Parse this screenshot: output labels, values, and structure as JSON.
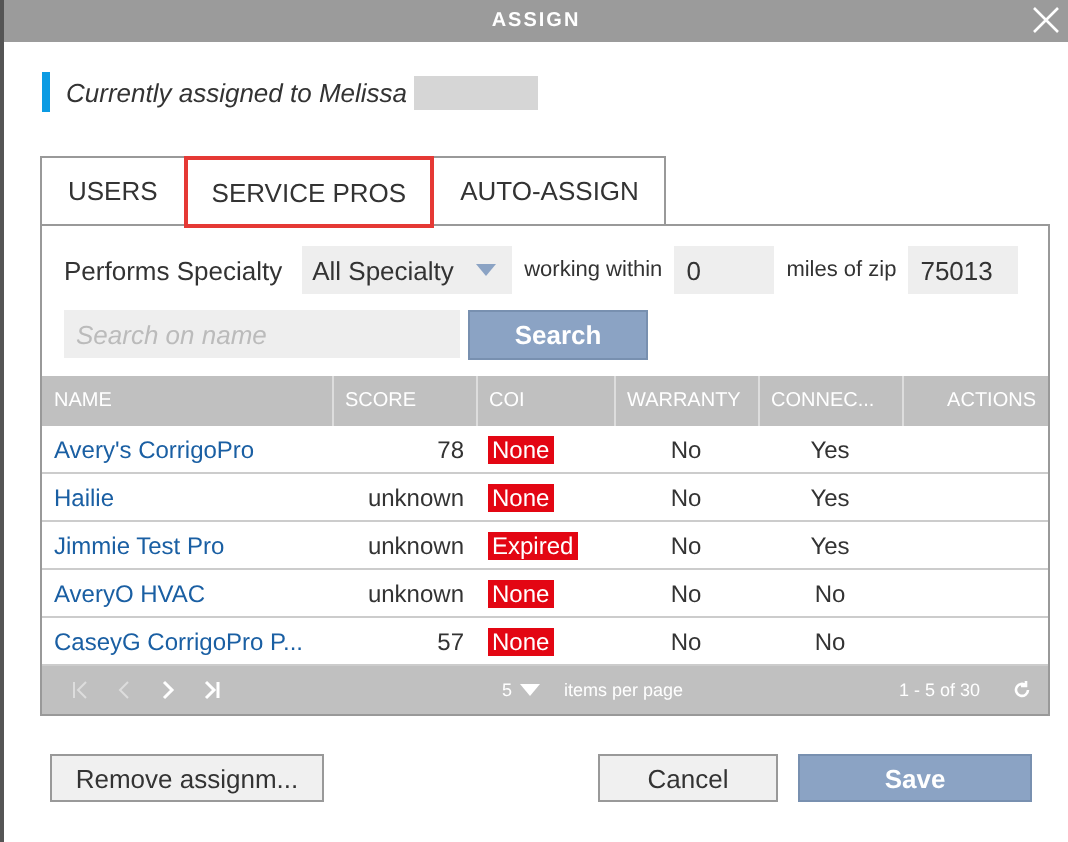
{
  "window": {
    "title": "ASSIGN"
  },
  "notice": {
    "text": "Currently assigned to Melissa"
  },
  "tabs": [
    {
      "label": "USERS",
      "selected": false
    },
    {
      "label": "SERVICE PROS",
      "selected": true
    },
    {
      "label": "AUTO-ASSIGN",
      "selected": false
    }
  ],
  "filters": {
    "specialty_label": "Performs Specialty",
    "specialty_value": "All Specialty",
    "within_label": "working within",
    "miles_value": "0",
    "zip_label": "miles of zip",
    "zip_value": "75013",
    "search": {
      "placeholder": "Search on name"
    },
    "search_button": "Search"
  },
  "table": {
    "columns": [
      "NAME",
      "SCORE",
      "COI",
      "WARRANTY",
      "CONNEC...",
      "ACTIONS"
    ],
    "rows": [
      {
        "name": "Avery's CorrigoPro",
        "score": "78",
        "coi": "None",
        "warranty": "No",
        "connected": "Yes"
      },
      {
        "name": "Hailie",
        "score": "unknown",
        "coi": "None",
        "warranty": "No",
        "connected": "Yes"
      },
      {
        "name": "Jimmie Test Pro",
        "score": "unknown",
        "coi": "Expired",
        "warranty": "No",
        "connected": "Yes"
      },
      {
        "name": "AveryO HVAC",
        "score": "unknown",
        "coi": "None",
        "warranty": "No",
        "connected": "No"
      },
      {
        "name": "CaseyG CorrigoPro P...",
        "score": "57",
        "coi": "None",
        "warranty": "No",
        "connected": "No"
      }
    ]
  },
  "pager": {
    "page_size": "5",
    "page_size_label": "items per page",
    "range": "1 - 5 of 30"
  },
  "buttons": {
    "remove": "Remove assignm...",
    "cancel": "Cancel",
    "save": "Save"
  }
}
